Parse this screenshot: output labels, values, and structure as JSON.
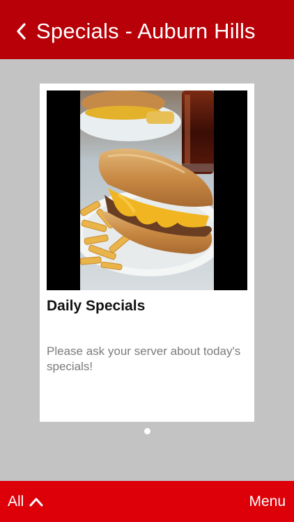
{
  "header": {
    "title": "Specials - Auburn Hills",
    "back_icon": "chevron-left-icon"
  },
  "card": {
    "title": "Daily Specials",
    "description": "Please ask your server about today's specials!",
    "image": "cheesesteak-sandwich-with-fries-photo"
  },
  "pager": {
    "current": 1,
    "total": 1
  },
  "footer": {
    "all_label": "All",
    "all_icon": "chevron-up-icon",
    "menu_label": "Menu"
  },
  "colors": {
    "header_bg": "#b70007",
    "footer_bg": "#dd0008",
    "page_bg": "#c3c3c3"
  }
}
